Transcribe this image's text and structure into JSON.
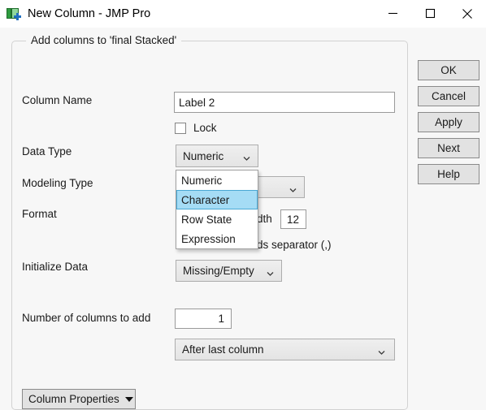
{
  "window": {
    "title": "New Column - JMP Pro",
    "icon": "new-column-icon",
    "controls": {
      "minimize": "minimize-icon",
      "maximize": "maximize-icon",
      "close": "close-icon"
    }
  },
  "groupbox": {
    "legend": "Add columns to 'final Stacked'"
  },
  "fields": {
    "column_name": {
      "label": "Column Name",
      "value": "Label 2",
      "placeholder": ""
    },
    "lock": {
      "label": "Lock",
      "checked": false
    },
    "data_type": {
      "label": "Data Type",
      "value": "Numeric",
      "options": [
        "Numeric",
        "Character",
        "Row State",
        "Expression"
      ],
      "highlighted": "Character",
      "open": true
    },
    "modeling_type": {
      "label": "Modeling Type",
      "value": ""
    },
    "format": {
      "label": "Format",
      "width_label": "dth",
      "width_value": "12",
      "separator_label": "ds separator (,)"
    },
    "initialize_data": {
      "label": "Initialize Data",
      "value": "Missing/Empty"
    },
    "number_of_columns": {
      "label": "Number of columns to add",
      "value": "1"
    },
    "position": {
      "value": "After last column"
    },
    "column_properties": {
      "label": "Column Properties"
    }
  },
  "buttons": {
    "ok": "OK",
    "cancel": "Cancel",
    "apply": "Apply",
    "next": "Next",
    "help": "Help"
  },
  "colors": {
    "dialog_bg": "#f7f7f7",
    "highlight": "#a5dcf5",
    "highlight_border": "#49a8d4",
    "button_face": "#e2e2e2"
  }
}
